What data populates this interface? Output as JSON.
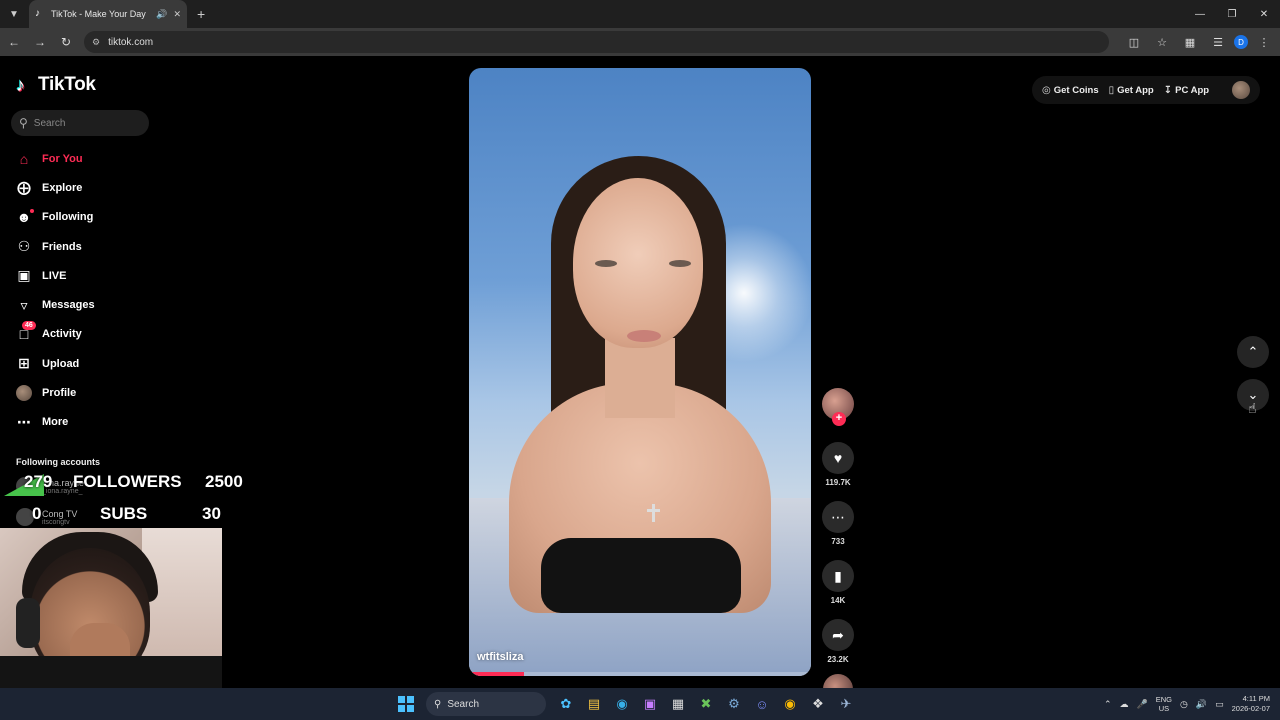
{
  "browser": {
    "tab_title": "TikTok - Make Your Day",
    "url": "tiktok.com",
    "profile_initial": "D"
  },
  "tiktok": {
    "logo_text": "TikTok",
    "search_placeholder": "Search",
    "nav": [
      {
        "label": "For You",
        "icon": "home-icon",
        "active": true
      },
      {
        "label": "Explore",
        "icon": "compass-icon"
      },
      {
        "label": "Following",
        "icon": "following-icon"
      },
      {
        "label": "Friends",
        "icon": "friends-icon"
      },
      {
        "label": "LIVE",
        "icon": "live-icon"
      },
      {
        "label": "Messages",
        "icon": "messages-icon"
      },
      {
        "label": "Activity",
        "icon": "activity-icon",
        "badge": "46"
      },
      {
        "label": "Upload",
        "icon": "upload-icon"
      },
      {
        "label": "Profile",
        "icon": "profile-avatar"
      },
      {
        "label": "More",
        "icon": "more-icon"
      }
    ],
    "following_title": "Following accounts",
    "following_accounts": [
      {
        "name": "iona.rayne",
        "handle": "_iona.rayne_"
      },
      {
        "name": "Cong TV",
        "handle": "itscongtv"
      }
    ],
    "top_right": {
      "get_coins": "Get Coins",
      "get_app": "Get App",
      "pc_app": "PC App"
    },
    "video": {
      "username": "wtfitsliza",
      "progress": 0.16
    },
    "actions": {
      "likes": "119.7K",
      "comments": "733",
      "saves": "14K",
      "shares": "23.2K"
    }
  },
  "overlay": {
    "followers_count": "279",
    "followers_label": "FOLLOWERS",
    "followers_goal": "2500",
    "subs_count": "0",
    "subs_label": "SUBS",
    "subs_goal": "30"
  },
  "taskbar": {
    "search_label": "Search",
    "lang_1": "ENG",
    "lang_2": "US",
    "time": "4:11 PM",
    "date": "2026-02-07"
  },
  "colors": {
    "accent": "#fe2c55",
    "taskbar": "#1c2433"
  }
}
